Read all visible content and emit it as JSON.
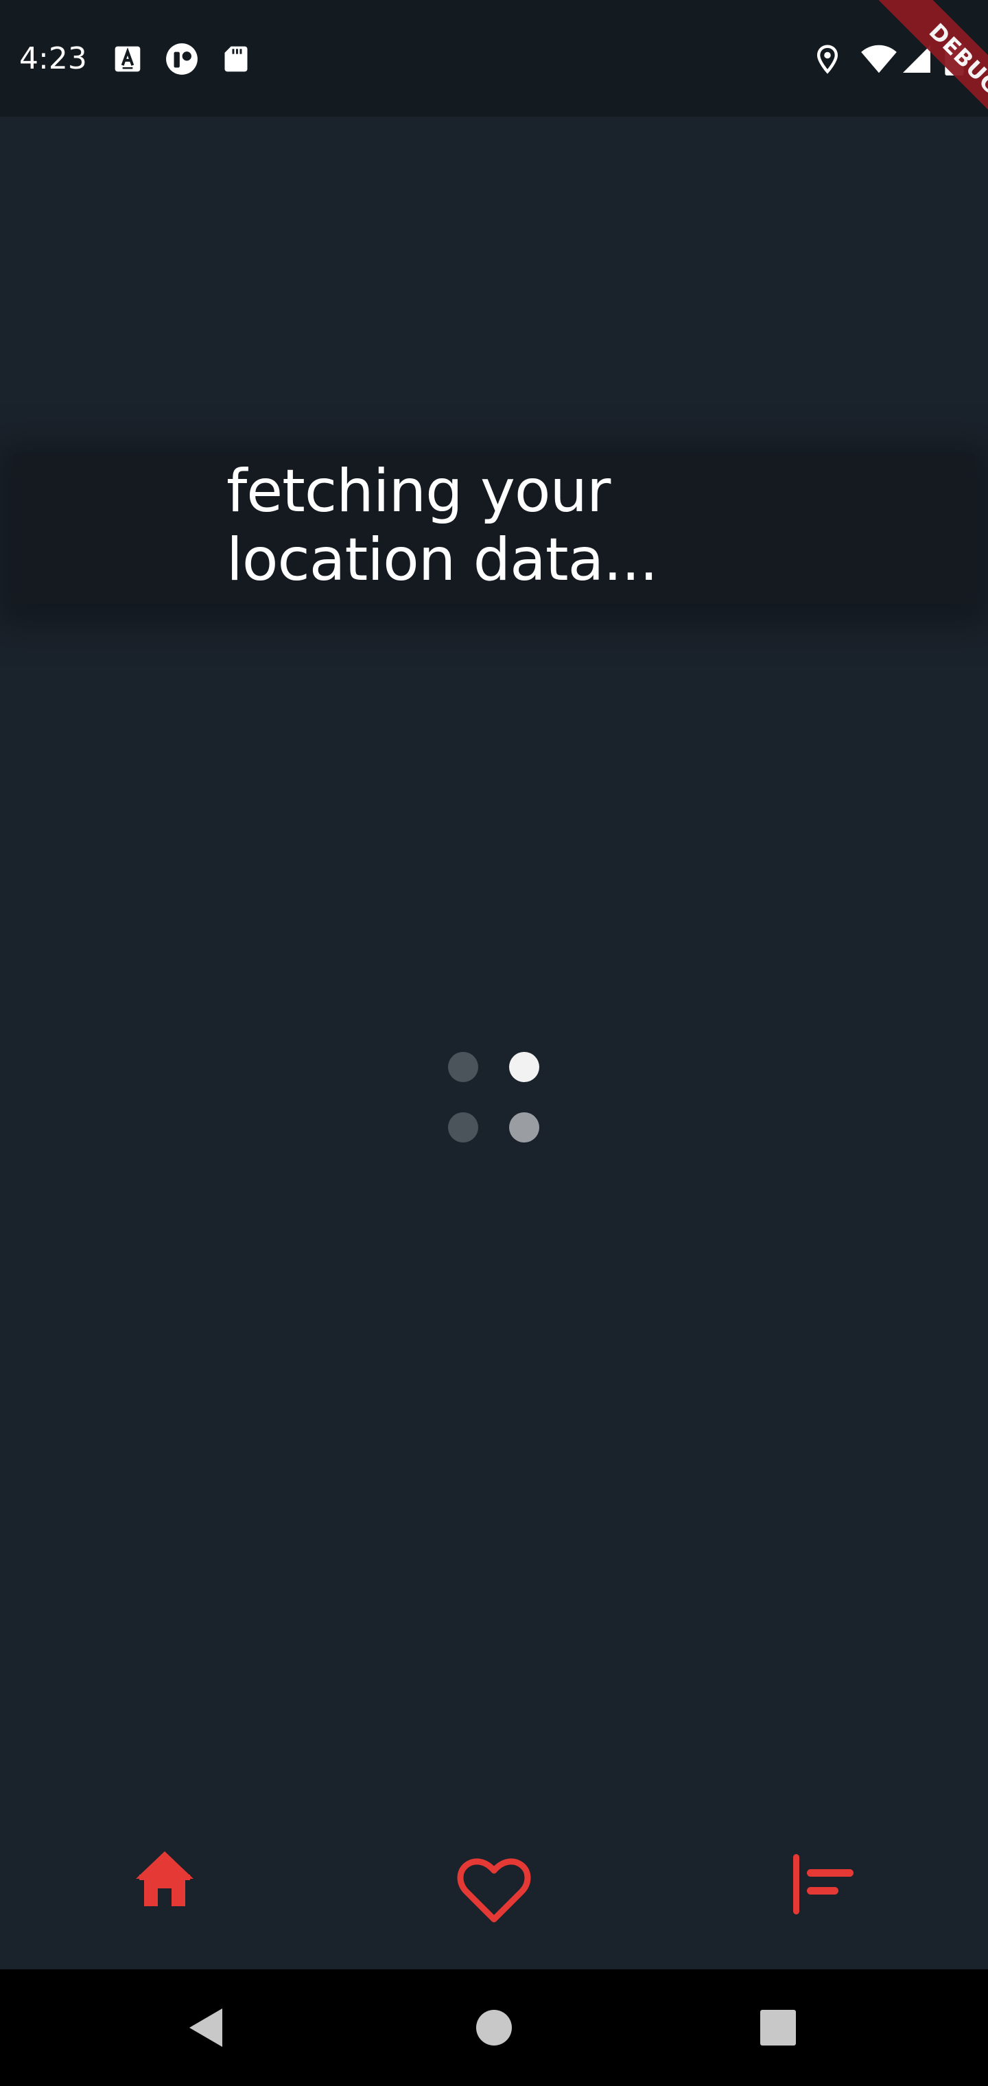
{
  "status_bar": {
    "time": "4:23",
    "left_icons": [
      "font-a-icon",
      "app-notification-icon",
      "sd-card-icon"
    ],
    "right_icons": [
      "location-pin-icon",
      "wifi-icon",
      "cellular-signal-icon",
      "battery-icon"
    ]
  },
  "debug_banner": {
    "label": "DEBUG"
  },
  "loading": {
    "message": "fetching your\nlocation data..."
  },
  "spinner": {
    "dots": [
      {
        "name": "top-left",
        "color": "#4c545b"
      },
      {
        "name": "top-right",
        "color": "#f2f2f2"
      },
      {
        "name": "bottom-left",
        "color": "#4c545b"
      },
      {
        "name": "bottom-right",
        "color": "#9a9ea2"
      }
    ]
  },
  "bottom_nav": {
    "accent_color": "#e53935",
    "items": [
      {
        "name": "home",
        "icon": "home-icon"
      },
      {
        "name": "favorites",
        "icon": "heart-icon"
      },
      {
        "name": "sort",
        "icon": "sort-align-icon"
      }
    ]
  },
  "system_nav": {
    "buttons": [
      "back-icon",
      "home-circle-icon",
      "recents-square-icon"
    ]
  },
  "colors": {
    "background": "#1a222b",
    "status_bar": "#131a20",
    "banner": "#141a20",
    "text": "#ffffff",
    "debug_ribbon": "#8b1a22"
  }
}
